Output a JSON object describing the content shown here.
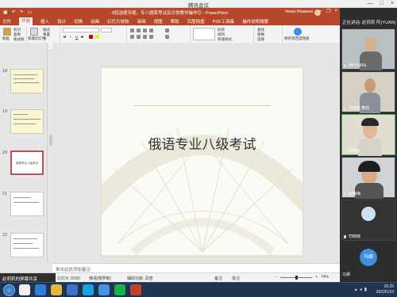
{
  "meeting": {
    "title": "腾讯会议",
    "minimize": "—",
    "maximize": "□",
    "close": "×"
  },
  "ppt": {
    "doc_title": "8招选题专题，专八题库考试及日常教学操作引 - PowerPoint",
    "user_name": "Чиаю Мажков",
    "tabs": [
      "文件",
      "开始",
      "插入",
      "设计",
      "切换",
      "动画",
      "幻灯片放映",
      "审阅",
      "视图",
      "帮助",
      "百度网盘",
      "PDF工具集",
      "操作说明搜索"
    ],
    "ribbon": {
      "clipboard": {
        "label": "剪贴板",
        "paste": "粘贴",
        "cut": "剪切",
        "copy": "复制",
        "format": "格式刷"
      },
      "slides": {
        "label": "幻灯片",
        "new": "新建幻灯片",
        "layout": "版式",
        "reset": "重置",
        "section": "节"
      },
      "font": {
        "label": "字体",
        "bold": "B",
        "italic": "I",
        "underline": "U",
        "strike": "S"
      },
      "paragraph": {
        "label": "段落"
      },
      "drawing": {
        "label": "绘图",
        "shapes": "形状",
        "arrange": "排列",
        "quick_styles": "快速样式"
      },
      "editing": {
        "label": "编辑",
        "find": "查找",
        "replace": "替换",
        "select": "选择"
      },
      "save": {
        "label": "保存",
        "action": "保存到百度网盘"
      }
    },
    "thumbs": [
      {
        "num": "18"
      },
      {
        "num": "19"
      },
      {
        "num": "20",
        "text": "俄语专业八级考试"
      },
      {
        "num": "21"
      },
      {
        "num": "22"
      }
    ],
    "slide_title": "俄语专业八级考试",
    "notes_placeholder": "单击此处添加备注",
    "status": {
      "slide": "幻灯片 20/50",
      "lang": "俄语(俄罗斯)",
      "accessibility": "辅助功能: 调查",
      "notes": "备注",
      "comments": "批注",
      "zoom": "74%"
    }
  },
  "share_bar": {
    "label": "赵莉莉的屏幕共享"
  },
  "side": {
    "speaking": "正在讲话: 赵莉莉  阿(YUAN)",
    "tiles": [
      {
        "name": "阿(YUAN)"
      },
      {
        "name": "王晓慧 教授"
      },
      {
        "name": "张思Ai"
      },
      {
        "name": "赵梅梅"
      },
      {
        "name": "司晓晓"
      }
    ],
    "mahu": {
      "avatar": "马娜",
      "name": "马娜"
    }
  },
  "taskbar": {
    "time": "15:25",
    "date": "2022/1/10"
  }
}
